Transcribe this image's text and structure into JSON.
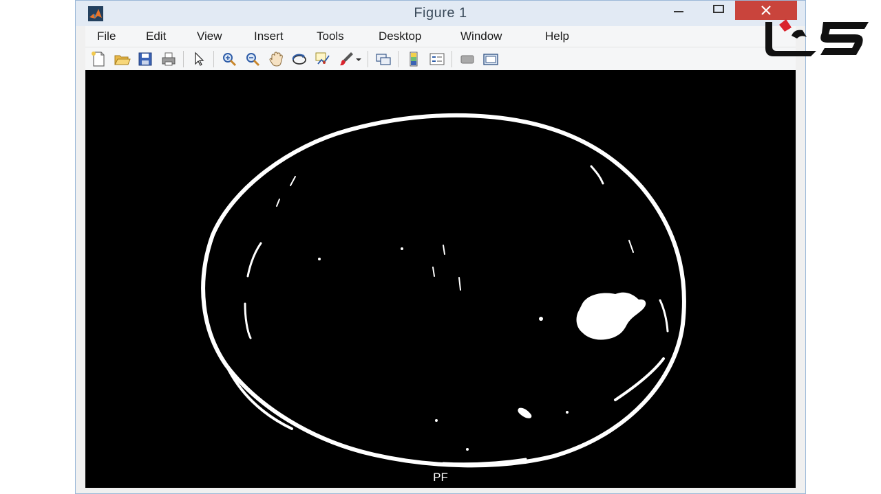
{
  "window": {
    "title": "Figure 1",
    "app_icon": "matlab-icon",
    "controls": [
      "minimize-icon",
      "maximize-icon",
      "close-icon"
    ]
  },
  "menu": {
    "items": [
      "File",
      "Edit",
      "View",
      "Insert",
      "Tools",
      "Desktop",
      "Window",
      "Help"
    ]
  },
  "toolbar": {
    "icons": [
      "new-figure-icon",
      "open-file-icon",
      "save-icon",
      "print-icon",
      "edit-plot-arrow-icon",
      "zoom-in-icon",
      "zoom-out-icon",
      "pan-hand-icon",
      "rotate-3d-icon",
      "data-cursor-icon",
      "brush-icon",
      "brush-dropdown-icon",
      "link-plot-icon",
      "colorbar-icon",
      "legend-icon",
      "hide-plot-tools-icon",
      "show-plot-tools-icon"
    ]
  },
  "figure": {
    "xlabel": "PF",
    "background": "#000000",
    "foreground": "#ffffff"
  },
  "branding": {
    "logo": "site-logo",
    "accent": "#d9232d"
  }
}
